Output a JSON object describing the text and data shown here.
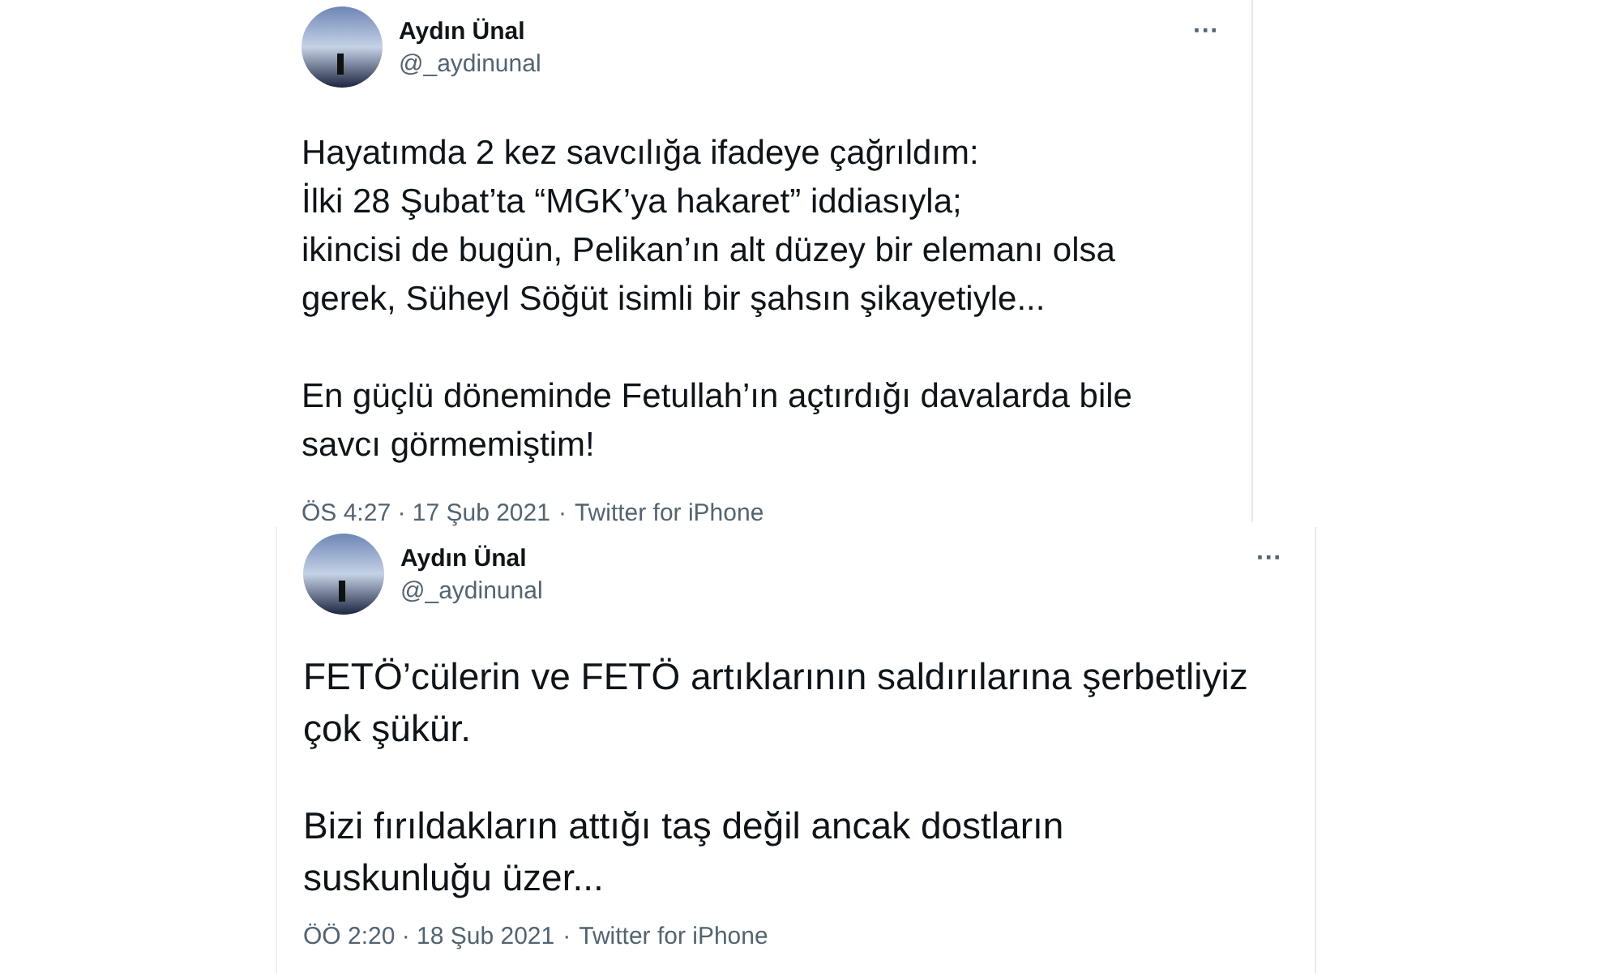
{
  "tweets": [
    {
      "name": "Aydın Ünal",
      "handle": "@_aydinunal",
      "more": "···",
      "paragraphs": [
        "Hayatımda 2 kez savcılığa ifadeye çağrıldım:\nİlki 28 Şubat’ta “MGK’ya hakaret” iddiasıyla;\nikincisi de bugün, Pelikan’ın alt düzey bir elemanı olsa\ngerek, Süheyl Söğüt isimli bir şahsın şikayetiyle...",
        "En güçlü döneminde Fetullah’ın açtırdığı davalarda bile\nsavcı görmemiştim!"
      ],
      "timestamp": "ÖS 4:27 · 17 Şub 2021",
      "separator": "·",
      "source": "Twitter for iPhone"
    },
    {
      "name": "Aydın Ünal",
      "handle": "@_aydinunal",
      "more": "···",
      "paragraphs": [
        "FETÖ’cülerin ve FETÖ artıklarının saldırılarına şerbetliyiz\nçok şükür.",
        "Bizi fırıldakların attığı taş değil ancak dostların\nsuskunluğu üzer..."
      ],
      "timestamp": "ÖÖ 2:20 · 18 Şub 2021",
      "separator": "·",
      "source": "Twitter for iPhone"
    }
  ]
}
